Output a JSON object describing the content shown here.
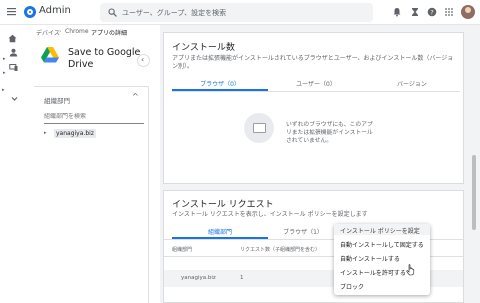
{
  "header": {
    "app_title": "Admin",
    "search_placeholder": "ユーザー、グループ、設定を検索"
  },
  "breadcrumb": [
    "デバイス",
    "Chrome",
    "アプリの詳細"
  ],
  "app": {
    "name": "Save to Google Drive"
  },
  "org_panel": {
    "title": "組織部門",
    "search_placeholder": "組織部門を検索",
    "root": "yanagiya.biz"
  },
  "install_card": {
    "title": "インストール数",
    "description": "アプリまたは拡張機能がインストールされているブラウザとユーザー、およびインストール数（バージョン別）。",
    "tabs": [
      "ブラウザ（0）",
      "ユーザー（0）",
      "バージョン"
    ],
    "empty_message": "いずれのブラウザにも、このアプリまたは拡張機能がインストールされていません。"
  },
  "request_card": {
    "title": "インストール リクエスト",
    "description": "インストール リクエストを表示し、インストール ポリシーを設定します",
    "tabs": [
      "組織部門",
      "ブラウザ（1）"
    ],
    "columns": [
      "組織部門",
      "リクエスト数（子組織部門を含む）"
    ],
    "rows": [
      {
        "org": "yanagiya.biz",
        "count": "1"
      }
    ]
  },
  "context_menu": {
    "items": [
      "インストール ポリシーを設定",
      "自動インストールして固定する",
      "自動インストールする",
      "インストールを許可する",
      "ブロック"
    ]
  },
  "colors": {
    "accent": "#1a73e8",
    "background": "#f1f3f4"
  }
}
